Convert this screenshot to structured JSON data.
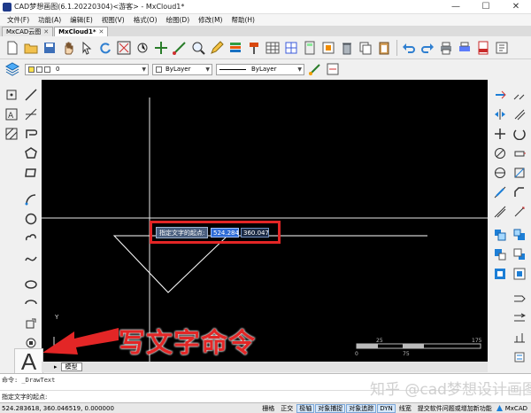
{
  "window": {
    "title": "CAD梦想画图(6.1.20220304)<游客> - MxCloud1*",
    "minimize": "—",
    "maximize": "☐",
    "close": "✕"
  },
  "menu": [
    "文件(F)",
    "功能(A)",
    "编辑(E)",
    "视图(V)",
    "格式(O)",
    "绘图(D)",
    "修改(M)",
    "帮助(H)"
  ],
  "tabs": [
    {
      "label": "MxCAD云图"
    },
    {
      "label": "MxCloud1*"
    }
  ],
  "tab_close": "✕",
  "properties": {
    "layer": "0",
    "color": "ByLayer",
    "linetype": "ByLayer"
  },
  "canvas": {
    "prompt": "指定文字的起点:",
    "x_value": "524.284",
    "y_value": "360.047",
    "axis_y": "Y",
    "axis_x": "X",
    "scale_labels": [
      "25",
      "175",
      "0",
      "75"
    ]
  },
  "caption": "写文字命令",
  "text_tool_glyph": "A",
  "model_tab": "模型",
  "command": {
    "history": "命令: _DrawText",
    "prompt": "指定文字的起点:"
  },
  "status": {
    "coords": "524.283618, 360.046519, 0.000000",
    "toggles": [
      {
        "label": "栅格",
        "on": false
      },
      {
        "label": "正交",
        "on": false
      },
      {
        "label": "极轴",
        "on": true
      },
      {
        "label": "对象捕捉",
        "on": true
      },
      {
        "label": "对象追踪",
        "on": true
      },
      {
        "label": "DYN",
        "on": true
      },
      {
        "label": "线宽",
        "on": false
      },
      {
        "label": "提交软件问题或增加新功能",
        "on": false
      }
    ],
    "brand": "MxCAD"
  },
  "watermark": "知乎 @cad梦想设计画图",
  "colors": {
    "accent": "#e32626",
    "canvas": "#000000",
    "input_active": "#2e6bd6"
  }
}
